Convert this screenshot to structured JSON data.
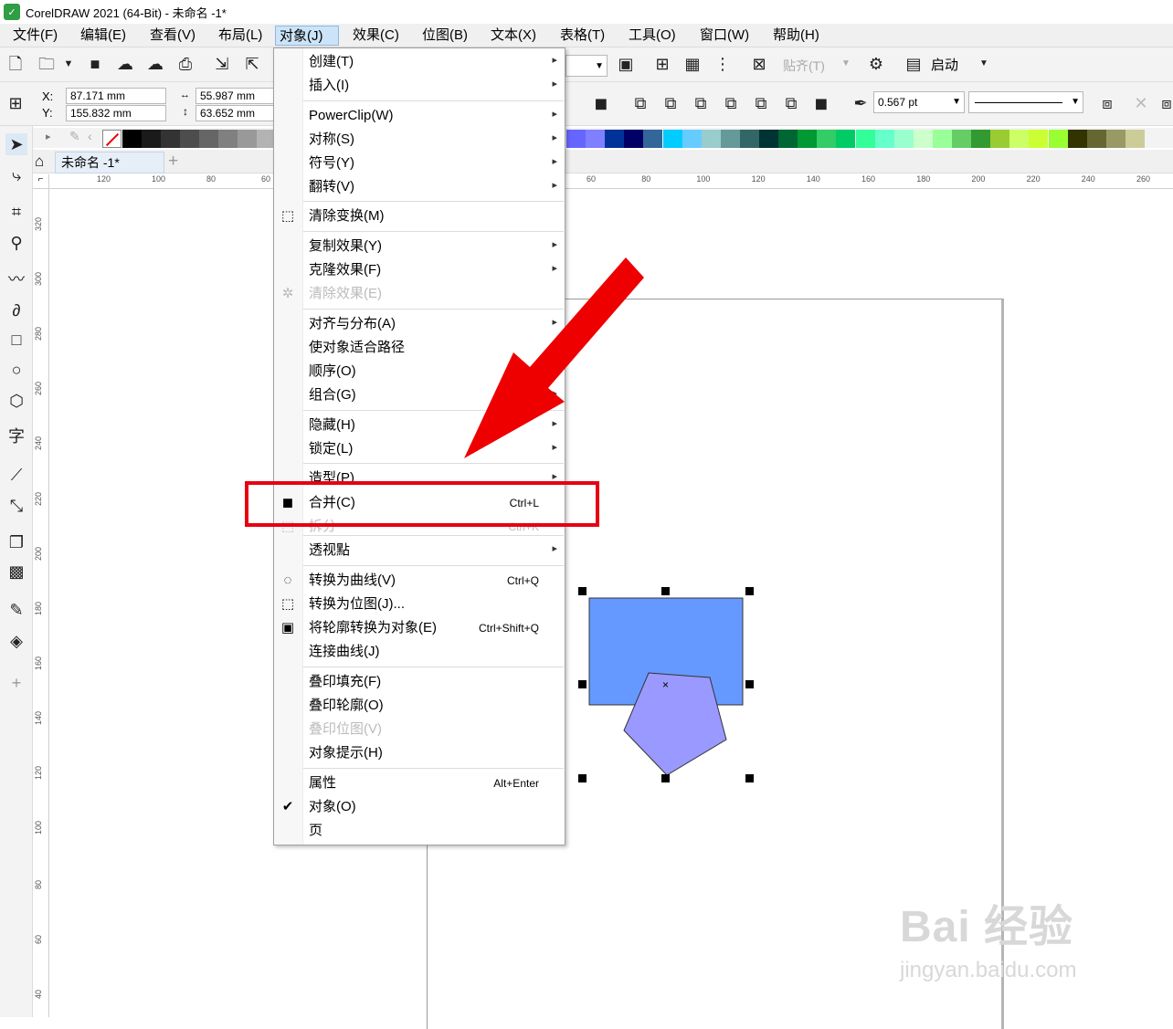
{
  "title_bar": {
    "text": "CorelDRAW 2021 (64-Bit) - 未命名 -1*"
  },
  "menu_bar": {
    "items": [
      "文件(F)",
      "编辑(E)",
      "查看(V)",
      "布局(L)",
      "对象(J)",
      "效果(C)",
      "位图(B)",
      "文本(X)",
      "表格(T)",
      "工具(O)",
      "窗口(W)",
      "帮助(H)"
    ],
    "active": "对象(J)"
  },
  "property_bar": {
    "x_label": "X:",
    "y_label": "Y:",
    "x_value": "87.171 mm",
    "y_value": "155.832 mm",
    "width_value": "55.987 mm",
    "height_value": "63.652 mm",
    "outline_width": "0.567 pt",
    "snap_label": "贴齐(T)",
    "launch_label": "启动"
  },
  "document_tab": {
    "label": "未命名 -1*"
  },
  "rulers": {
    "h_ticks_left": [
      "120",
      "100",
      "80",
      "60"
    ],
    "h_ticks_right": [
      "60",
      "80",
      "100",
      "120",
      "140",
      "160",
      "180",
      "200",
      "220",
      "240",
      "260"
    ],
    "v_ticks": [
      "320",
      "300",
      "280",
      "260",
      "240",
      "220",
      "200",
      "180",
      "160",
      "140",
      "120",
      "100",
      "80",
      "60",
      "40"
    ]
  },
  "dropdown_menu": {
    "items": [
      {
        "label": "创建(T)",
        "submenu": true
      },
      {
        "label": "插入(I)",
        "submenu": true
      },
      {
        "label": "PowerClip(W)",
        "submenu": true
      },
      {
        "label": "对称(S)",
        "submenu": true
      },
      {
        "label": "符号(Y)",
        "submenu": true
      },
      {
        "label": "翻转(V)",
        "submenu": true
      },
      {
        "label": "清除变换(M)",
        "icon": "clear-transform-icon"
      },
      {
        "label": "复制效果(Y)",
        "submenu": true
      },
      {
        "label": "克隆效果(F)",
        "submenu": true
      },
      {
        "label": "清除效果(E)",
        "disabled": true,
        "icon": "clear-effect-icon"
      },
      {
        "label": "对齐与分布(A)",
        "submenu": true
      },
      {
        "label": "使对象适合路径"
      },
      {
        "label": "顺序(O)",
        "submenu": true
      },
      {
        "label": "组合(G)",
        "submenu": true
      },
      {
        "label": "隐藏(H)",
        "submenu": true
      },
      {
        "label": "锁定(L)",
        "submenu": true
      },
      {
        "label": "造型(P)",
        "submenu": true
      },
      {
        "label": "合并(C)",
        "shortcut": "Ctrl+L",
        "icon": "combine-icon"
      },
      {
        "label": "拆分",
        "shortcut": "Ctrl+K",
        "disabled": true,
        "icon": "break-apart-icon"
      },
      {
        "label": "透视點",
        "submenu": true
      },
      {
        "label": "转换为曲线(V)",
        "shortcut": "Ctrl+Q",
        "icon": "convert-curves-icon"
      },
      {
        "label": "转换为位图(J)...",
        "icon": "convert-bitmap-icon"
      },
      {
        "label": "将轮廓转换为对象(E)",
        "shortcut": "Ctrl+Shift+Q",
        "icon": "outline-object-icon"
      },
      {
        "label": "连接曲线(J)"
      },
      {
        "label": "叠印填充(F)"
      },
      {
        "label": "叠印轮廓(O)"
      },
      {
        "label": "叠印位图(V)",
        "disabled": true
      },
      {
        "label": "对象提示(H)"
      },
      {
        "label": "属性",
        "shortcut": "Alt+Enter"
      },
      {
        "label": "对象(O)",
        "checked": true
      },
      {
        "label": "页"
      }
    ]
  },
  "canvas": {
    "rect_color": "#6699ff",
    "pentagon_color": "#9999ff"
  },
  "annotation": {
    "highlight_color": "#e60012",
    "arrow_color": "#ee0000"
  },
  "watermark": {
    "line1": "Bai 经验",
    "line2": "jingyan.baidu.com"
  },
  "palette": [
    "#000000",
    "#1a1a1a",
    "#333333",
    "#4d4d4d",
    "#666666",
    "#808080",
    "#999999",
    "#b3b3b3",
    "#6666ff",
    "#7f7fff",
    "#003399",
    "#000066",
    "#336699",
    "#00ccff",
    "#66ccff",
    "#99cccc",
    "#669999",
    "#336666",
    "#003333",
    "#006633",
    "#009933",
    "#33cc66",
    "#00cc66",
    "#33ff99",
    "#66ffcc",
    "#99ffcc",
    "#ccffcc",
    "#99ff99",
    "#66cc66",
    "#339933",
    "#99cc33",
    "#ccff66",
    "#ccff33",
    "#99ff33",
    "#333300",
    "#666633",
    "#999966",
    "#cccc99"
  ]
}
